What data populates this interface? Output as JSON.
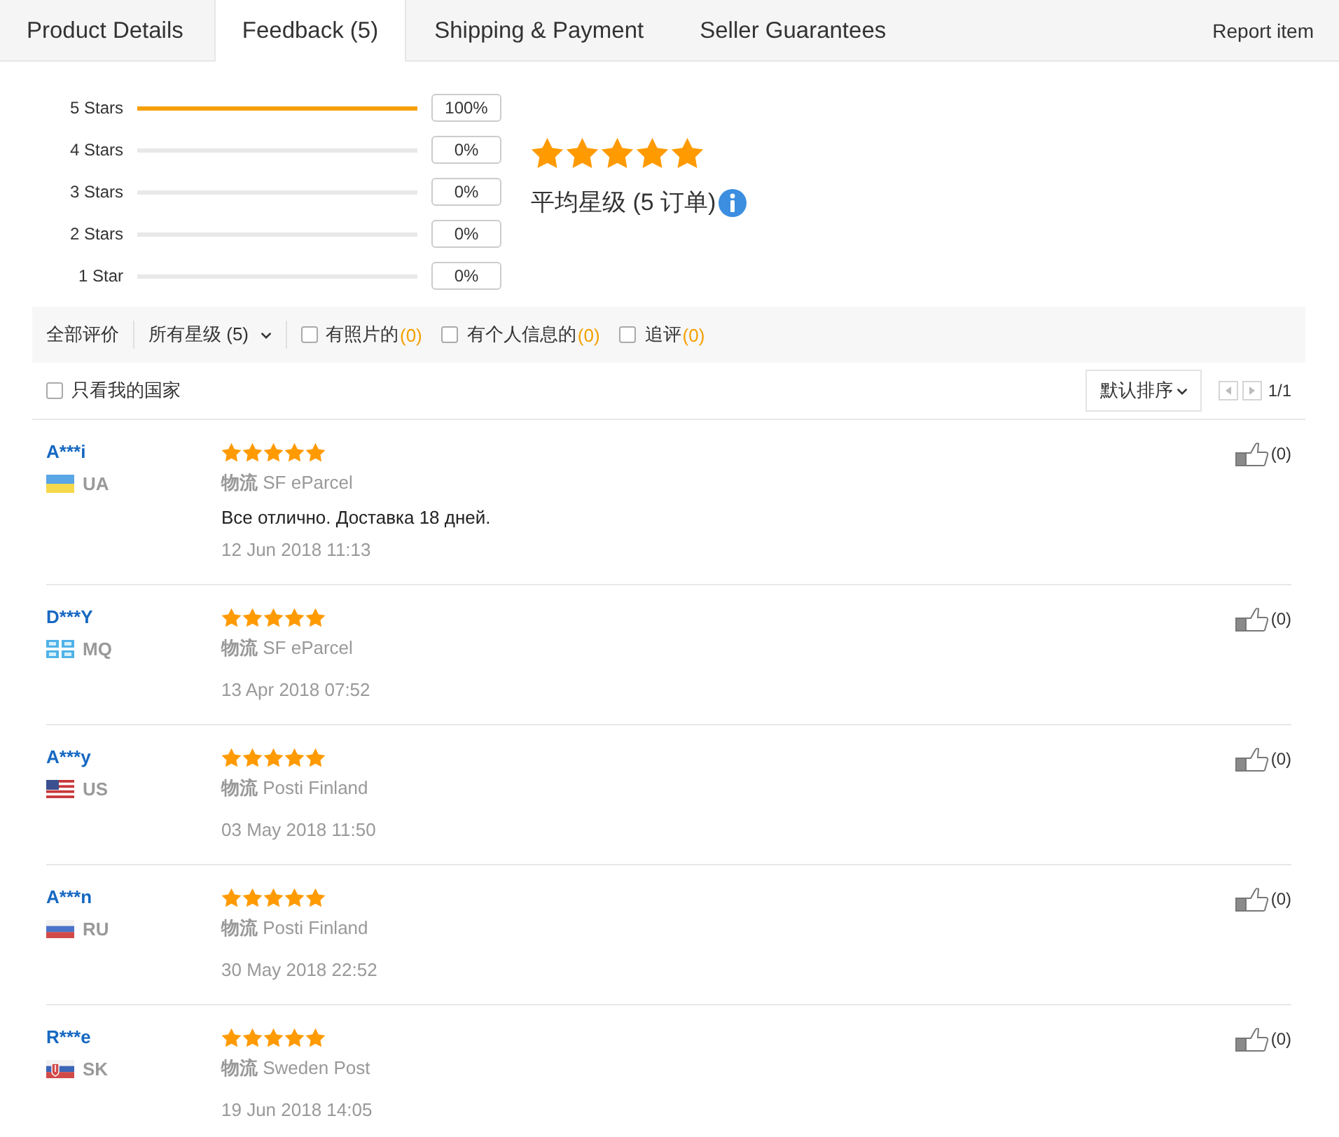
{
  "tabs": [
    {
      "label": "Product Details",
      "selected": false
    },
    {
      "label": "Feedback (5)",
      "selected": true
    },
    {
      "label": "Shipping & Payment",
      "selected": false
    },
    {
      "label": "Seller Guarantees",
      "selected": false
    }
  ],
  "report_link": "Report item",
  "rating_summary": {
    "distribution": [
      {
        "label": "5 Stars",
        "level": 1,
        "percent": "100%"
      },
      {
        "label": "4 Stars",
        "level": 0,
        "percent": "0%"
      },
      {
        "label": "3 Stars",
        "level": 0,
        "percent": "0%"
      },
      {
        "label": "2 Stars",
        "level": 0,
        "percent": "0%"
      },
      {
        "label": "1 Star",
        "level": 0,
        "percent": "0%"
      }
    ],
    "stars": 5,
    "average_text": "平均星级 (5 订单)"
  },
  "filter_bar": {
    "all_label": "全部评价",
    "star_filter": "所有星级 (5)",
    "options": [
      {
        "label": "有照片的",
        "count": "(0)",
        "checked": false
      },
      {
        "label": "有个人信息的",
        "count": "(0)",
        "checked": false
      },
      {
        "label": "追评",
        "count": "(0)",
        "checked": false
      }
    ]
  },
  "country_filter": {
    "label": "只看我的国家",
    "checked": false
  },
  "sort": {
    "label": "默认排序"
  },
  "pager": {
    "text": "1/1"
  },
  "reviews": [
    {
      "name": "A***i",
      "flag": {
        "kind": "ua"
      },
      "country": "UA",
      "stars": 5,
      "logistics": "**物流** SF eParcel",
      "comment": "Все отлично. Доставка 18 дней.",
      "date": "12 Jun 2018 11:13",
      "likes": "(0)"
    },
    {
      "name": "D***Y",
      "flag": {
        "kind": "mq"
      },
      "country": "MQ",
      "stars": 5,
      "logistics": "**物流** SF eParcel",
      "date": "13 Apr 2018 07:52",
      "likes": "(0)"
    },
    {
      "name": "A***y",
      "flag": {
        "kind": "us"
      },
      "country": "US",
      "stars": 5,
      "logistics": "**物流** Posti Finland",
      "date": "03 May 2018 11:50",
      "likes": "(0)"
    },
    {
      "name": "A***n",
      "flag": {
        "kind": "ru"
      },
      "country": "RU",
      "stars": 5,
      "logistics": "**物流** Posti Finland",
      "date": "30 May 2018 22:52",
      "likes": "(0)"
    },
    {
      "name": "R***e",
      "flag": {
        "kind": "sk"
      },
      "country": "SK",
      "stars": 5,
      "logistics": "**物流** Sweden Post",
      "date": "19 Jun 2018 14:05",
      "likes": "(0)"
    }
  ]
}
